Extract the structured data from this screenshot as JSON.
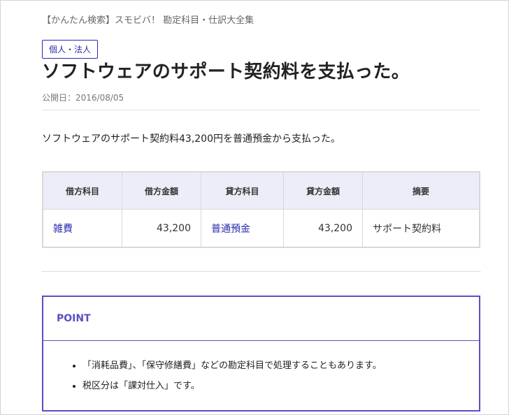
{
  "header": {
    "site_title": "【かんたん検索】スモビバ！ 勘定科目・仕訳大全集"
  },
  "article": {
    "category": "個人・法人",
    "title": "ソフトウェアのサポート契約料を支払った。",
    "published": "公開日：2016/08/05",
    "lead": "ソフトウェアのサポート契約料43,200円を普通預金から支払った。"
  },
  "journal": {
    "headers": [
      "借方科目",
      "借方金額",
      "貸方科目",
      "貸方金額",
      "摘要"
    ],
    "rows": [
      {
        "debit_account": "雑費",
        "debit_amount": "43,200",
        "credit_account": "普通預金",
        "credit_amount": "43,200",
        "memo": "サポート契約料"
      }
    ]
  },
  "point": {
    "heading": "POINT",
    "items": [
      "「消耗品費」、「保守修繕費」などの勘定科目で処理することもあります。",
      "税区分は「課対仕入」です。"
    ]
  },
  "colors": {
    "accent": "#5a4fc4",
    "link": "#2a2ab0",
    "table_header_bg": "#ededfa"
  }
}
